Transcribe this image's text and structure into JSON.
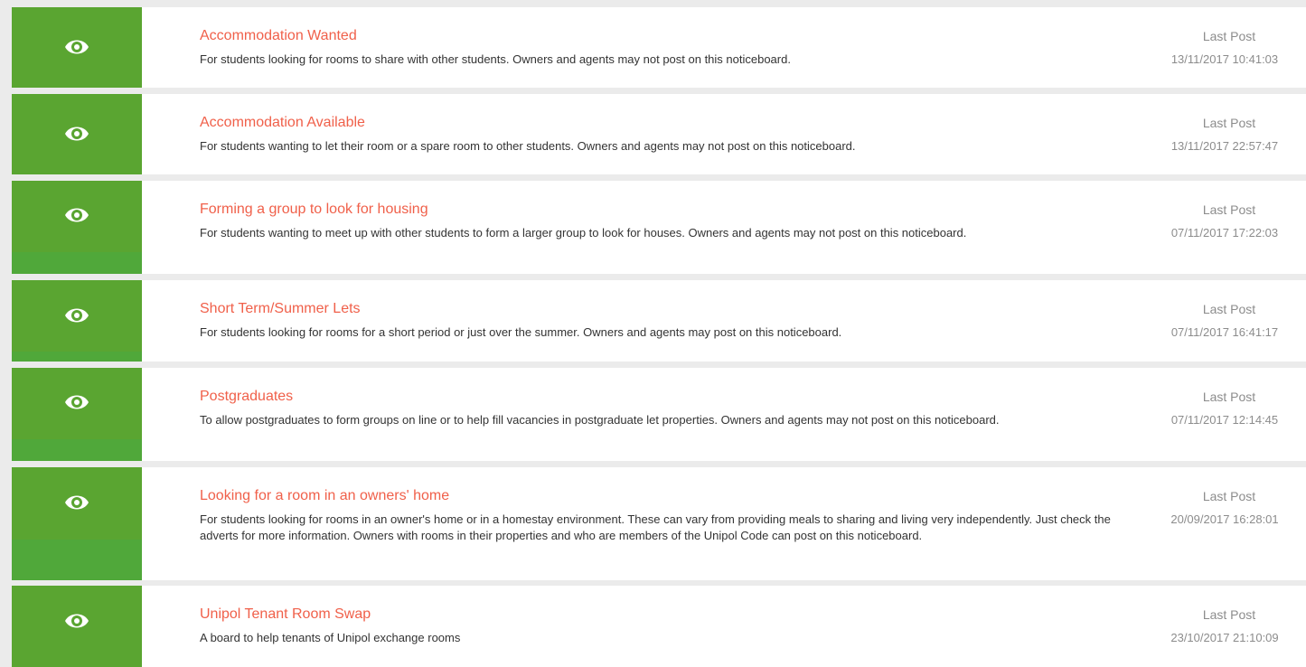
{
  "boards": [
    {
      "title": "Accommodation Wanted",
      "description": "For students looking for rooms to share with other students. Owners and agents may not post on this noticeboard.",
      "last_post_label": "Last Post",
      "last_post_date": "13/11/2017 10:41:03"
    },
    {
      "title": "Accommodation Available",
      "description": "For students wanting to let their room or a spare room to other students. Owners and agents may not post on this noticeboard.",
      "last_post_label": "Last Post",
      "last_post_date": "13/11/2017 22:57:47"
    },
    {
      "title": "Forming a group to look for housing",
      "description": "For students wanting to meet up with other students to form a larger group to look for houses. Owners and agents may not post on this noticeboard.",
      "last_post_label": "Last Post",
      "last_post_date": "07/11/2017 17:22:03"
    },
    {
      "title": "Short Term/Summer Lets",
      "description": "For students looking for rooms for a short period or just over the summer. Owners and agents may post on this noticeboard.",
      "last_post_label": "Last Post",
      "last_post_date": "07/11/2017 16:41:17"
    },
    {
      "title": "Postgraduates",
      "description": "To allow postgraduates to form groups on line or to help fill vacancies in postgraduate let properties. Owners and agents may not post on this noticeboard.",
      "last_post_label": "Last Post",
      "last_post_date": "07/11/2017 12:14:45"
    },
    {
      "title": "Looking for a room in an owners' home",
      "description": "For students looking for rooms in an owner's home or in a homestay environment. These can vary from providing meals to sharing and living very independently. Just check the adverts for more information. Owners with rooms in their properties and who are members of the Unipol Code can post on this noticeboard.",
      "last_post_label": "Last Post",
      "last_post_date": "20/09/2017 16:28:01"
    },
    {
      "title": "Unipol Tenant Room Swap",
      "description": "A board to help tenants of Unipol exchange rooms",
      "last_post_label": "Last Post",
      "last_post_date": "23/10/2017 21:10:09"
    }
  ],
  "icon": "eye-icon",
  "colors": {
    "tile_green": "#5aa531",
    "title_red": "#f0604a",
    "meta_grey": "#8c8c8c"
  }
}
